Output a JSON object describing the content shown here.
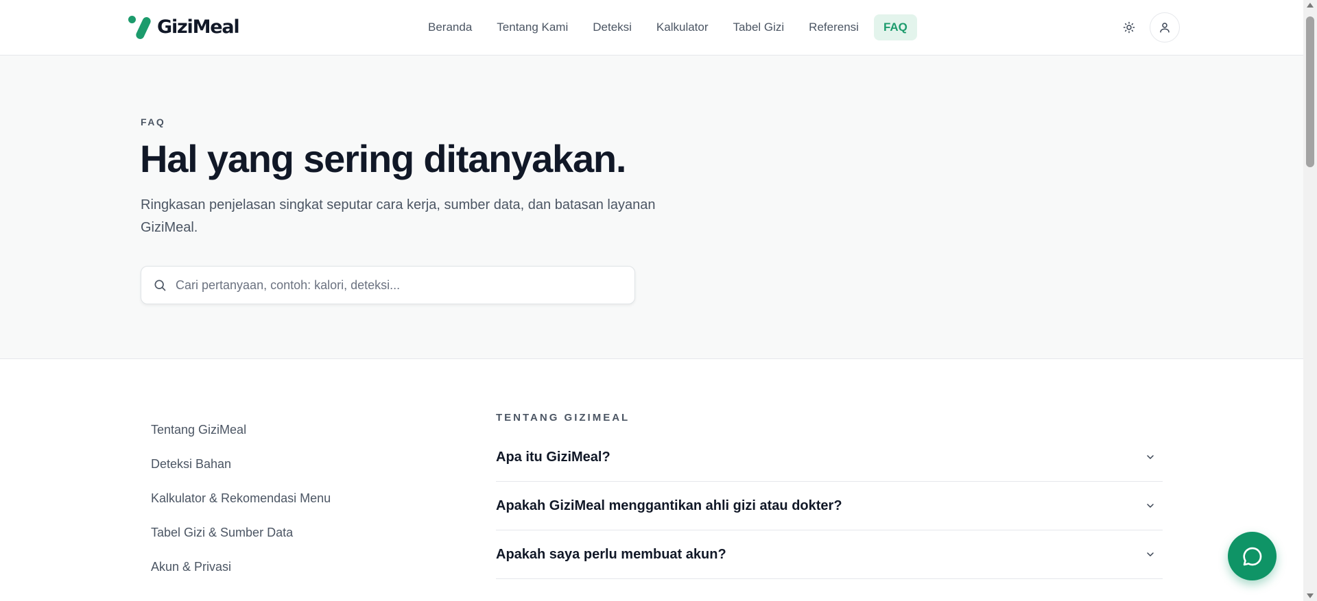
{
  "brand": {
    "name": "GiziMeal",
    "accent": "#1c9b6c"
  },
  "nav": {
    "items": [
      {
        "label": "Beranda"
      },
      {
        "label": "Tentang Kami"
      },
      {
        "label": "Deteksi"
      },
      {
        "label": "Kalkulator"
      },
      {
        "label": "Tabel Gizi"
      },
      {
        "label": "Referensi"
      },
      {
        "label": "FAQ",
        "active": true
      }
    ],
    "theme_icon": "sun-icon",
    "user_icon": "user-icon"
  },
  "hero": {
    "eyebrow": "FAQ",
    "title": "Hal yang sering ditanyakan.",
    "subtitle": "Ringkasan penjelasan singkat seputar cara kerja, sumber data, dan batasan layanan GiziMeal.",
    "search": {
      "placeholder": "Cari pertanyaan, contoh: kalori, deteksi...",
      "value": ""
    }
  },
  "sidebar": {
    "items": [
      {
        "label": "Tentang GiziMeal"
      },
      {
        "label": "Deteksi Bahan"
      },
      {
        "label": "Kalkulator & Rekomendasi Menu"
      },
      {
        "label": "Tabel Gizi & Sumber Data"
      },
      {
        "label": "Akun & Privasi"
      }
    ]
  },
  "faq": {
    "section_label": "TENTANG GIZIMEAL",
    "items": [
      {
        "question": "Apa itu GiziMeal?"
      },
      {
        "question": "Apakah GiziMeal menggantikan ahli gizi atau dokter?"
      },
      {
        "question": "Apakah saya perlu membuat akun?"
      }
    ]
  },
  "chat": {
    "icon": "chat-bubble-icon",
    "color": "#0f9466"
  }
}
